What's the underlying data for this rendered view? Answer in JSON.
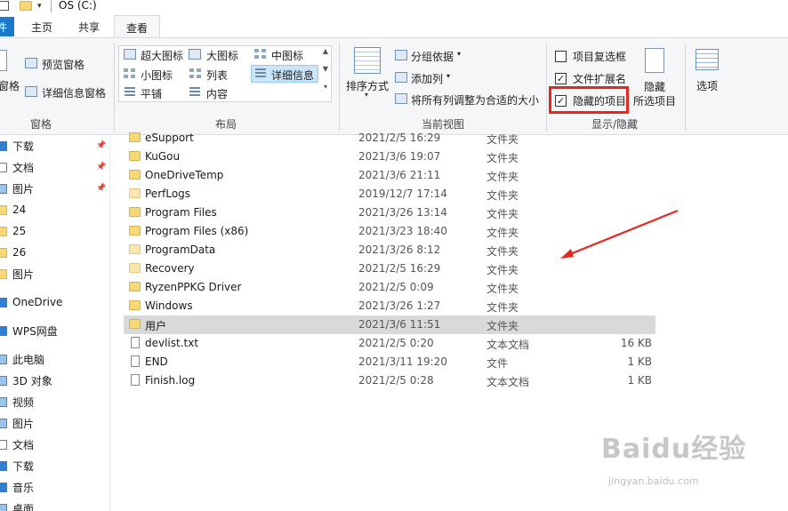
{
  "window": {
    "title": "OS (C:)"
  },
  "tabs": {
    "file": "件",
    "home": "主页",
    "share": "共享",
    "view": "查看"
  },
  "ribbon": {
    "pane_group": {
      "nav_pane_label": "窗格",
      "preview_pane": "预览窗格",
      "details_pane": "详细信息窗格",
      "group_label": "窗格"
    },
    "layout_group": {
      "items": [
        "超大图标",
        "大图标",
        "中图标",
        "小图标",
        "列表",
        "详细信息",
        "平铺",
        "内容"
      ],
      "group_label": "布局"
    },
    "current_view_group": {
      "sort_by": "排序方式",
      "group_by": "分组依据",
      "add_columns": "添加列",
      "size_all_columns": "将所有列调整为合适的大小",
      "group_label": "当前视图"
    },
    "show_hide_group": {
      "item_checkboxes": {
        "label": "项目复选框",
        "checked": false
      },
      "file_extensions": {
        "label": "文件扩展名",
        "checked": true
      },
      "hidden_items": {
        "label": "隐藏的项目",
        "checked": true
      },
      "hide_selected_line1": "隐藏",
      "hide_selected_line2": "所选项目",
      "group_label": "显示/隐藏"
    },
    "options": {
      "label": "选项"
    }
  },
  "nav": {
    "items": [
      {
        "label": "下载",
        "icon": "download-icon",
        "pinned": true
      },
      {
        "label": "文档",
        "icon": "documents-icon",
        "pinned": true
      },
      {
        "label": "图片",
        "icon": "pictures-icon",
        "pinned": true
      },
      {
        "label": "24",
        "icon": "folder-icon",
        "pinned": false
      },
      {
        "label": "25",
        "icon": "folder-icon",
        "pinned": false
      },
      {
        "label": "26",
        "icon": "folder-icon",
        "pinned": false
      },
      {
        "label": "图片",
        "icon": "folder-icon",
        "pinned": false
      },
      {
        "label": "OneDrive",
        "icon": "onedrive-icon",
        "pinned": false
      },
      {
        "label": "WPS网盘",
        "icon": "cloud-icon",
        "pinned": false
      },
      {
        "label": "此电脑",
        "icon": "computer-icon",
        "pinned": false
      },
      {
        "label": "3D 对象",
        "icon": "3d-objects-icon",
        "pinned": false
      },
      {
        "label": "视频",
        "icon": "videos-icon",
        "pinned": false
      },
      {
        "label": "图片",
        "icon": "pictures-icon",
        "pinned": false
      },
      {
        "label": "文档",
        "icon": "documents-icon",
        "pinned": false
      },
      {
        "label": "下载",
        "icon": "download-icon",
        "pinned": false
      },
      {
        "label": "音乐",
        "icon": "music-icon",
        "pinned": false
      },
      {
        "label": "桌面",
        "icon": "desktop-icon",
        "pinned": false
      }
    ]
  },
  "files": {
    "rows": [
      {
        "name": "eSupport",
        "date": "2021/2/5 16:29",
        "type": "文件夹",
        "size": "",
        "kind": "folder"
      },
      {
        "name": "KuGou",
        "date": "2021/3/6 19:07",
        "type": "文件夹",
        "size": "",
        "kind": "folder"
      },
      {
        "name": "OneDriveTemp",
        "date": "2021/3/6 21:11",
        "type": "文件夹",
        "size": "",
        "kind": "folder"
      },
      {
        "name": "PerfLogs",
        "date": "2019/12/7 17:14",
        "type": "文件夹",
        "size": "",
        "kind": "folder-light"
      },
      {
        "name": "Program Files",
        "date": "2021/3/26 13:14",
        "type": "文件夹",
        "size": "",
        "kind": "folder"
      },
      {
        "name": "Program Files (x86)",
        "date": "2021/3/23 18:40",
        "type": "文件夹",
        "size": "",
        "kind": "folder"
      },
      {
        "name": "ProgramData",
        "date": "2021/3/26 8:12",
        "type": "文件夹",
        "size": "",
        "kind": "folder-light"
      },
      {
        "name": "Recovery",
        "date": "2021/2/5 16:29",
        "type": "文件夹",
        "size": "",
        "kind": "folder-light"
      },
      {
        "name": "RyzenPPKG Driver",
        "date": "2021/2/5 0:09",
        "type": "文件夹",
        "size": "",
        "kind": "folder"
      },
      {
        "name": "Windows",
        "date": "2021/3/26 1:27",
        "type": "文件夹",
        "size": "",
        "kind": "folder"
      },
      {
        "name": "用户",
        "date": "2021/3/6 11:51",
        "type": "文件夹",
        "size": "",
        "kind": "folder"
      },
      {
        "name": "devlist.txt",
        "date": "2021/2/5 0:20",
        "type": "文本文档",
        "size": "16 KB",
        "kind": "file"
      },
      {
        "name": "END",
        "date": "2021/3/11 19:20",
        "type": "文件",
        "size": "1 KB",
        "kind": "file"
      },
      {
        "name": "Finish.log",
        "date": "2021/2/5 0:28",
        "type": "文本文档",
        "size": "1 KB",
        "kind": "file"
      }
    ],
    "selected_index": 10
  },
  "watermark": {
    "main": "Baidu经验",
    "sub": "jingyan.baidu.com"
  },
  "colors": {
    "accent": "#1979ca",
    "highlight_box": "#e8261c",
    "selection": "#d9d9d9"
  }
}
